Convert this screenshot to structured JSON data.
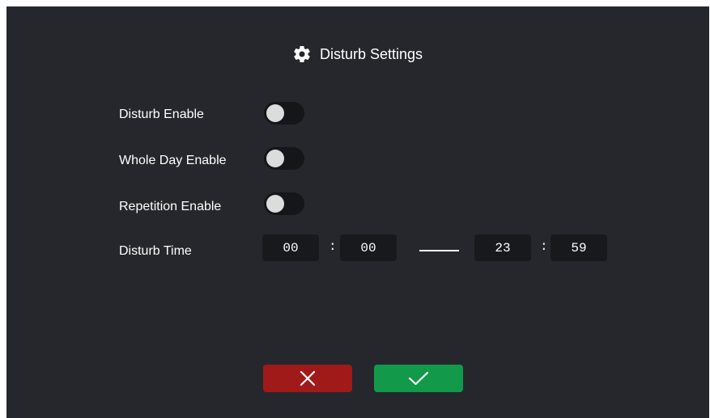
{
  "header": {
    "title": "Disturb Settings",
    "icon": "gear-icon"
  },
  "settings": [
    {
      "label": "Disturb Enable",
      "enabled": false
    },
    {
      "label": "Whole Day Enable",
      "enabled": false
    },
    {
      "label": "Repetition Enable",
      "enabled": false
    }
  ],
  "disturb_time": {
    "label": "Disturb Time",
    "start_hour": "00",
    "start_minute": "00",
    "end_hour": "23",
    "end_minute": "59",
    "separator": ":"
  },
  "actions": {
    "cancel_icon": "close-icon",
    "confirm_icon": "check-icon"
  },
  "colors": {
    "background": "#25272c",
    "cancel": "#a01a1a",
    "confirm": "#13994a"
  }
}
